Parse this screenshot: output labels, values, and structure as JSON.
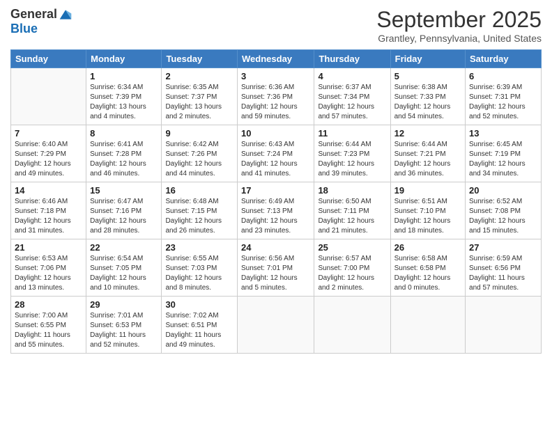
{
  "logo": {
    "general": "General",
    "blue": "Blue"
  },
  "title": {
    "month_year": "September 2025",
    "location": "Grantley, Pennsylvania, United States"
  },
  "days_of_week": [
    "Sunday",
    "Monday",
    "Tuesday",
    "Wednesday",
    "Thursday",
    "Friday",
    "Saturday"
  ],
  "weeks": [
    [
      {
        "day": "",
        "info": ""
      },
      {
        "day": "1",
        "info": "Sunrise: 6:34 AM\nSunset: 7:39 PM\nDaylight: 13 hours\nand 4 minutes."
      },
      {
        "day": "2",
        "info": "Sunrise: 6:35 AM\nSunset: 7:37 PM\nDaylight: 13 hours\nand 2 minutes."
      },
      {
        "day": "3",
        "info": "Sunrise: 6:36 AM\nSunset: 7:36 PM\nDaylight: 12 hours\nand 59 minutes."
      },
      {
        "day": "4",
        "info": "Sunrise: 6:37 AM\nSunset: 7:34 PM\nDaylight: 12 hours\nand 57 minutes."
      },
      {
        "day": "5",
        "info": "Sunrise: 6:38 AM\nSunset: 7:33 PM\nDaylight: 12 hours\nand 54 minutes."
      },
      {
        "day": "6",
        "info": "Sunrise: 6:39 AM\nSunset: 7:31 PM\nDaylight: 12 hours\nand 52 minutes."
      }
    ],
    [
      {
        "day": "7",
        "info": "Sunrise: 6:40 AM\nSunset: 7:29 PM\nDaylight: 12 hours\nand 49 minutes."
      },
      {
        "day": "8",
        "info": "Sunrise: 6:41 AM\nSunset: 7:28 PM\nDaylight: 12 hours\nand 46 minutes."
      },
      {
        "day": "9",
        "info": "Sunrise: 6:42 AM\nSunset: 7:26 PM\nDaylight: 12 hours\nand 44 minutes."
      },
      {
        "day": "10",
        "info": "Sunrise: 6:43 AM\nSunset: 7:24 PM\nDaylight: 12 hours\nand 41 minutes."
      },
      {
        "day": "11",
        "info": "Sunrise: 6:44 AM\nSunset: 7:23 PM\nDaylight: 12 hours\nand 39 minutes."
      },
      {
        "day": "12",
        "info": "Sunrise: 6:44 AM\nSunset: 7:21 PM\nDaylight: 12 hours\nand 36 minutes."
      },
      {
        "day": "13",
        "info": "Sunrise: 6:45 AM\nSunset: 7:19 PM\nDaylight: 12 hours\nand 34 minutes."
      }
    ],
    [
      {
        "day": "14",
        "info": "Sunrise: 6:46 AM\nSunset: 7:18 PM\nDaylight: 12 hours\nand 31 minutes."
      },
      {
        "day": "15",
        "info": "Sunrise: 6:47 AM\nSunset: 7:16 PM\nDaylight: 12 hours\nand 28 minutes."
      },
      {
        "day": "16",
        "info": "Sunrise: 6:48 AM\nSunset: 7:15 PM\nDaylight: 12 hours\nand 26 minutes."
      },
      {
        "day": "17",
        "info": "Sunrise: 6:49 AM\nSunset: 7:13 PM\nDaylight: 12 hours\nand 23 minutes."
      },
      {
        "day": "18",
        "info": "Sunrise: 6:50 AM\nSunset: 7:11 PM\nDaylight: 12 hours\nand 21 minutes."
      },
      {
        "day": "19",
        "info": "Sunrise: 6:51 AM\nSunset: 7:10 PM\nDaylight: 12 hours\nand 18 minutes."
      },
      {
        "day": "20",
        "info": "Sunrise: 6:52 AM\nSunset: 7:08 PM\nDaylight: 12 hours\nand 15 minutes."
      }
    ],
    [
      {
        "day": "21",
        "info": "Sunrise: 6:53 AM\nSunset: 7:06 PM\nDaylight: 12 hours\nand 13 minutes."
      },
      {
        "day": "22",
        "info": "Sunrise: 6:54 AM\nSunset: 7:05 PM\nDaylight: 12 hours\nand 10 minutes."
      },
      {
        "day": "23",
        "info": "Sunrise: 6:55 AM\nSunset: 7:03 PM\nDaylight: 12 hours\nand 8 minutes."
      },
      {
        "day": "24",
        "info": "Sunrise: 6:56 AM\nSunset: 7:01 PM\nDaylight: 12 hours\nand 5 minutes."
      },
      {
        "day": "25",
        "info": "Sunrise: 6:57 AM\nSunset: 7:00 PM\nDaylight: 12 hours\nand 2 minutes."
      },
      {
        "day": "26",
        "info": "Sunrise: 6:58 AM\nSunset: 6:58 PM\nDaylight: 12 hours\nand 0 minutes."
      },
      {
        "day": "27",
        "info": "Sunrise: 6:59 AM\nSunset: 6:56 PM\nDaylight: 11 hours\nand 57 minutes."
      }
    ],
    [
      {
        "day": "28",
        "info": "Sunrise: 7:00 AM\nSunset: 6:55 PM\nDaylight: 11 hours\nand 55 minutes."
      },
      {
        "day": "29",
        "info": "Sunrise: 7:01 AM\nSunset: 6:53 PM\nDaylight: 11 hours\nand 52 minutes."
      },
      {
        "day": "30",
        "info": "Sunrise: 7:02 AM\nSunset: 6:51 PM\nDaylight: 11 hours\nand 49 minutes."
      },
      {
        "day": "",
        "info": ""
      },
      {
        "day": "",
        "info": ""
      },
      {
        "day": "",
        "info": ""
      },
      {
        "day": "",
        "info": ""
      }
    ]
  ]
}
